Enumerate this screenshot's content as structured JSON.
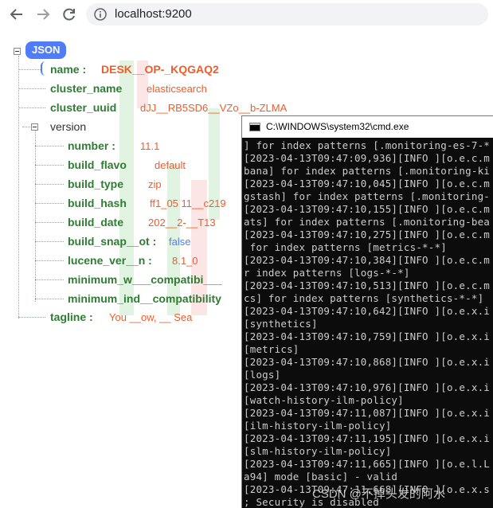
{
  "browser": {
    "url": "localhost:9200",
    "icons": {
      "back": "arrow-left-icon",
      "forward": "arrow-right-icon",
      "reload": "reload-icon",
      "info": "info-icon"
    }
  },
  "viewer": {
    "root_label": "JSON",
    "name_key": "name :",
    "name_val": "DESK__OP-_KQGAQ2",
    "cluster_name_key": "cluster_name",
    "cluster_name_val": "elasticsearch",
    "cluster_uuid_key": "cluster_uuid",
    "cluster_uuid_val": "dJJ__RB5SD6__VZo__b-ZLMA",
    "version_key": "version",
    "version": {
      "number_key": "number :",
      "number_val": "11.1",
      "build_flavor_key": "build_flavo",
      "build_flavor_val": "default",
      "build_type_key": "build_type",
      "build_type_val": "zip",
      "build_hash_key": "build_hash",
      "build_hash_val": "ff1_05 11__c219",
      "build_date_key": "build_date",
      "build_date_val": "202__2-__T13",
      "build_snapshot_key": "build_snap__ot :",
      "build_snapshot_val": "false",
      "lucene_version_key": "lucene_ver__n :",
      "lucene_version_val": "8.1_0",
      "min_wire_key": "minimum_w___compatibi___",
      "min_index_key": "minimum_ind__compatibility"
    },
    "tagline_key": "tagline :",
    "tagline_val": "You __ow, __ Sea"
  },
  "cmd": {
    "title": "C:\\WINDOWS\\system32\\cmd.exe",
    "lines": [
      "] for index patterns [.monitoring-es-7-*",
      "[2023-04-13T09:47:09,936][INFO ][o.e.c.m",
      "bana] for index patterns [.monitoring-ki",
      "[2023-04-13T09:47:10,045][INFO ][o.e.c.m",
      "gstash] for index patterns [.monitoring-",
      "[2023-04-13T09:47:10,155][INFO ][o.e.c.m",
      "ats] for index patterns [.monitoring-bea",
      "[2023-04-13T09:47:10,275][INFO ][o.e.c.m",
      " for index patterns [metrics-*-*]",
      "[2023-04-13T09:47:10,384][INFO ][o.e.c.m",
      "r index patterns [logs-*-*]",
      "[2023-04-13T09:47:10,513][INFO ][o.e.c.m",
      "cs] for index patterns [synthetics-*-*]",
      "[2023-04-13T09:47:10,642][INFO ][o.e.x.i",
      "[synthetics]",
      "[2023-04-13T09:47:10,759][INFO ][o.e.x.i",
      "[metrics]",
      "[2023-04-13T09:47:10,868][INFO ][o.e.x.i",
      "[logs]",
      "[2023-04-13T09:47:10,976][INFO ][o.e.x.i",
      "[watch-history-ilm-policy]",
      "[2023-04-13T09:47:11,087][INFO ][o.e.x.i",
      "[ilm-history-ilm-policy]",
      "[2023-04-13T09:47:11,195][INFO ][o.e.x.i",
      "[slm-history-ilm-policy]",
      "[2023-04-13T09:47:11,665][INFO ][o.e.l.L",
      "a94] mode [basic] - valid",
      "[2023-04-13T09:47:11,668][INFO ][o.e.x.s",
      "; Security is disabled"
    ]
  },
  "watermark": "CSDN @不掉头发的阿水"
}
